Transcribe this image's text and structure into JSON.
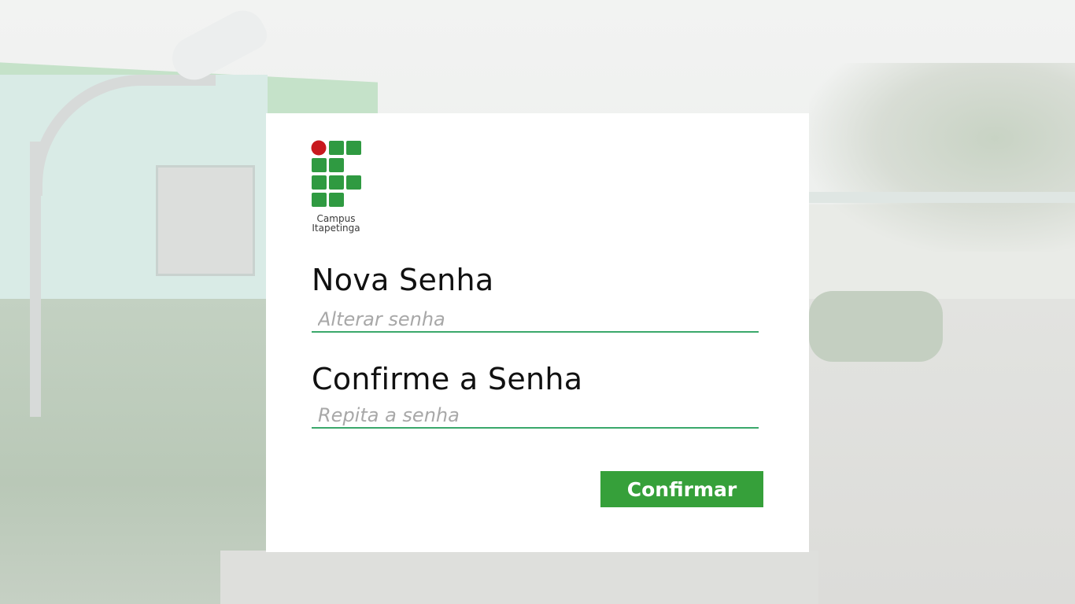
{
  "background": {
    "description_icon": "campus-photo"
  },
  "logo": {
    "icon": "ifbaiano-logo-icon",
    "caption_line1": "Campus",
    "caption_line2": "Itapetinga",
    "colors": {
      "green": "#2f9a41",
      "red": "#c8191e"
    }
  },
  "form": {
    "new_password_label": "Nova Senha",
    "new_password_placeholder": "Alterar senha",
    "confirm_password_label": "Confirme a Senha",
    "confirm_password_placeholder": "Repita a senha",
    "submit_label": "Confirmar"
  },
  "colors": {
    "accent": "#36a03a",
    "input_underline": "#3aa86b"
  }
}
